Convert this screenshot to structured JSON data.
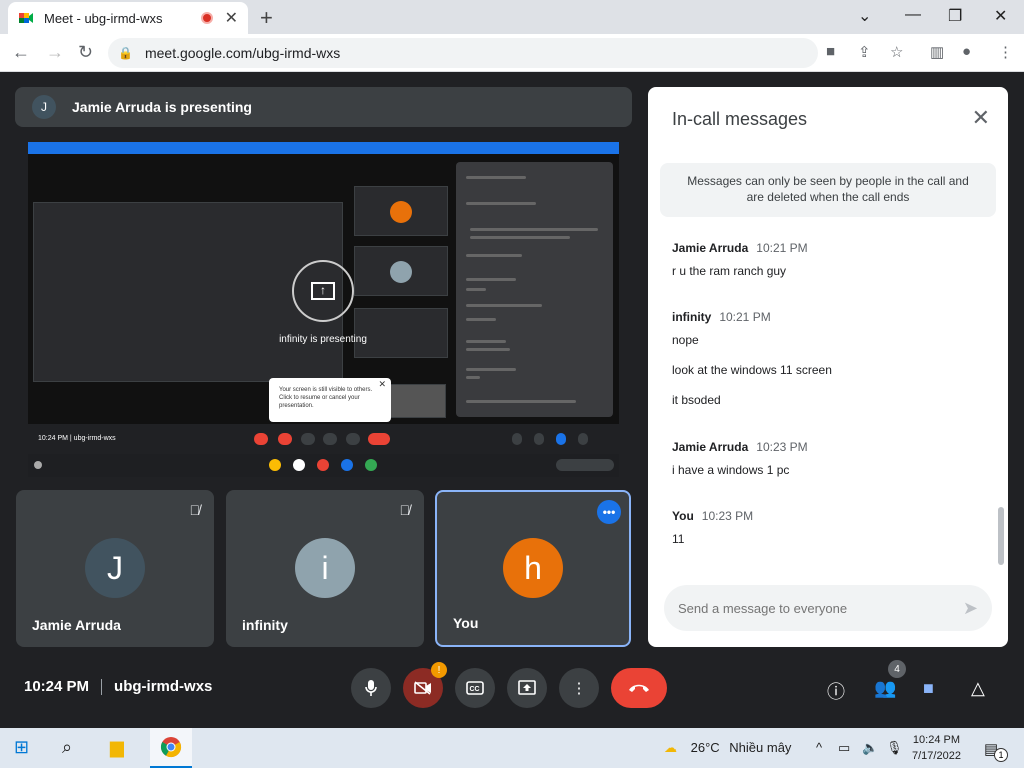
{
  "browser": {
    "tab_title": "Meet - ubg-irmd-wxs",
    "url": "meet.google.com/ubg-irmd-wxs"
  },
  "presenter_banner": {
    "initial": "J",
    "text": "Jamie Arruda is presenting"
  },
  "shared_screen": {
    "presenting_text": "infinity is presenting",
    "tooltip": "Your screen is still visible to others. Click to resume or cancel your presentation.",
    "mini_meeting_info": "10:24 PM  |  ubg-irmd-wxs"
  },
  "tiles": [
    {
      "initial": "J",
      "name": "Jamie Arruda",
      "color": "#41535f"
    },
    {
      "initial": "i",
      "name": "infinity",
      "color": "#8fa3ad"
    },
    {
      "initial": "h",
      "name": "You",
      "color": "#e8710a"
    }
  ],
  "chat": {
    "title": "In-call messages",
    "notice": "Messages can only be seen by people in the call and are deleted when the call ends",
    "messages": [
      {
        "sender": "Jamie Arruda",
        "time": "10:21 PM",
        "lines": [
          "r u the ram ranch guy"
        ]
      },
      {
        "sender": "infinity",
        "time": "10:21 PM",
        "lines": [
          "nope",
          "look at the windows 11 screen",
          "it bsoded"
        ]
      },
      {
        "sender": "Jamie Arruda",
        "time": "10:23 PM",
        "lines": [
          "i have a windows 1 pc"
        ]
      },
      {
        "sender": "You",
        "time": "10:23 PM",
        "lines": [
          "11"
        ]
      }
    ],
    "input_placeholder": "Send a message to everyone"
  },
  "controls": {
    "time": "10:24 PM",
    "meeting_code": "ubg-irmd-wxs",
    "camera_alert": "!",
    "people_count": "4"
  },
  "taskbar": {
    "temperature": "26°C",
    "weather": "Nhiều mây",
    "clock_time": "10:24 PM",
    "clock_date": "7/17/2022",
    "notification_count": "1"
  }
}
